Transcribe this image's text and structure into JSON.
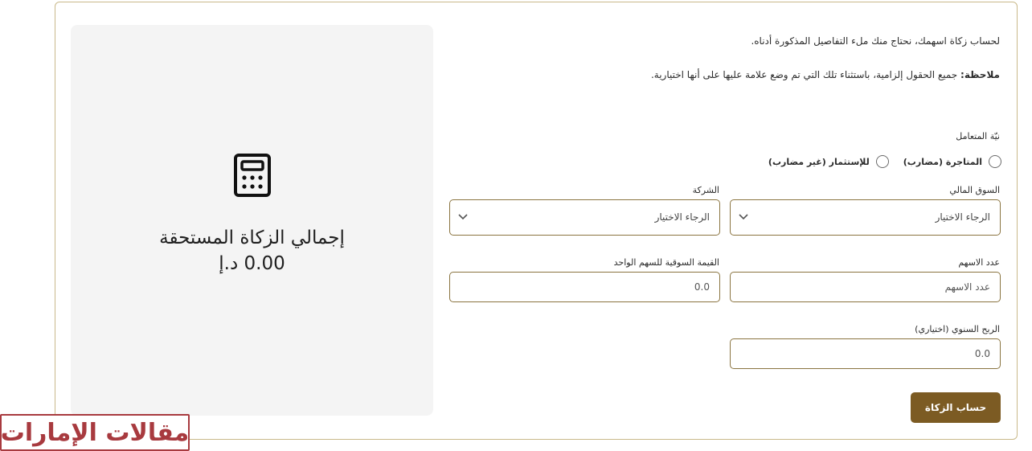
{
  "intro_text": "لحساب زكاة اسهمك، نحتاج منك ملء التفاصيل المذكورة أدناه.",
  "note": {
    "prefix": "ملاحظة:",
    "text": " جميع الحقول إلزامية، باستثناء تلك التي تم وضع علامة عليها على أنها اختيارية."
  },
  "intent": {
    "label": "نيّة المتعامل",
    "options": [
      "المتاجرة (مضارب)",
      "للإستثمار (غير مضارب)"
    ]
  },
  "market": {
    "label": "السوق المالي",
    "value": "الرجاء الاختيار"
  },
  "company": {
    "label": "الشركة",
    "value": "الرجاء الاختيار"
  },
  "shares": {
    "label": "عدد الاسهم",
    "placeholder": "عدد الاسهم"
  },
  "market_value": {
    "label": "القيمة السوقية للسهم الواحد",
    "value": "0.0"
  },
  "annual_profit": {
    "label": "الربح السنوي (اختياري)",
    "value": "0.0"
  },
  "calculate_button": "حساب الزكاة",
  "result": {
    "title": "إجمالي الزكاة المستحقة",
    "value": "0.00 د.إ"
  },
  "icons": {
    "calculator": "calculator-icon",
    "chevron": "chevron-down-icon",
    "radio": "radio-unchecked-icon"
  },
  "watermark_text": "مقالات الإمارات",
  "colors": {
    "accent": "#7c5b23",
    "border": "#8a7440",
    "frame": "#c9b98a",
    "card_bg": "#f4f4f4",
    "logo_red": "#a83a3f"
  }
}
